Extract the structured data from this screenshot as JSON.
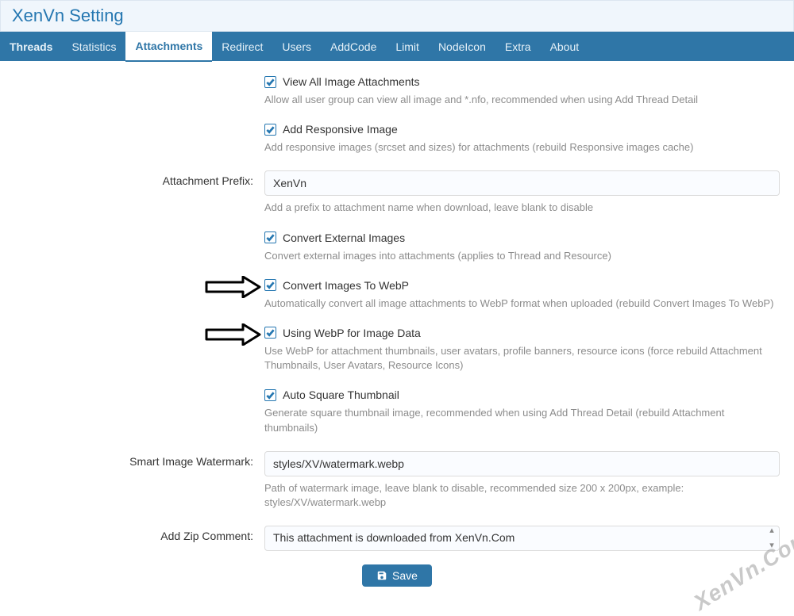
{
  "header": {
    "title": "XenVn Setting"
  },
  "tabs": {
    "items": [
      {
        "label": "Threads",
        "bold": true
      },
      {
        "label": "Statistics"
      },
      {
        "label": "Attachments",
        "active": true,
        "bold": true
      },
      {
        "label": "Redirect"
      },
      {
        "label": "Users"
      },
      {
        "label": "AddCode"
      },
      {
        "label": "Limit"
      },
      {
        "label": "NodeIcon"
      },
      {
        "label": "Extra"
      },
      {
        "label": "About"
      }
    ]
  },
  "options": {
    "viewAll": {
      "label": "View All Image Attachments",
      "desc": "Allow all user group can view all image and *.nfo, recommended when using Add Thread Detail",
      "checked": true
    },
    "responsive": {
      "label": "Add Responsive Image",
      "desc": "Add responsive images (srcset and sizes) for attachments (rebuild Responsive images cache)",
      "checked": true
    },
    "prefix": {
      "row_label": "Attachment Prefix:",
      "value": "XenVn",
      "desc": "Add a prefix to attachment name when download, leave blank to disable"
    },
    "convertExt": {
      "label": "Convert External Images",
      "desc": "Convert external images into attachments (applies to Thread and Resource)",
      "checked": true
    },
    "convertWebP": {
      "label": "Convert Images To WebP",
      "desc": "Automatically convert all image attachments to WebP format when uploaded (rebuild Convert Images To WebP)",
      "checked": true
    },
    "useWebP": {
      "label": "Using WebP for Image Data",
      "desc": "Use WebP for attachment thumbnails, user avatars, profile banners, resource icons (force rebuild Attachment Thumbnails, User Avatars, Resource Icons)",
      "checked": true
    },
    "autoSquare": {
      "label": "Auto Square Thumbnail",
      "desc": "Generate square thumbnail image, recommended when using Add Thread Detail (rebuild Attachment thumbnails)",
      "checked": true
    },
    "watermark": {
      "row_label": "Smart Image Watermark:",
      "value": "styles/XV/watermark.webp",
      "desc": "Path of watermark image, leave blank to disable, recommended size 200 x 200px, example: styles/XV/watermark.webp"
    },
    "zip": {
      "row_label": "Add Zip Comment:",
      "value": "This attachment is downloaded from XenVn.Com"
    }
  },
  "footer": {
    "save_label": "Save"
  },
  "overlay_text": "XenVn.Com"
}
